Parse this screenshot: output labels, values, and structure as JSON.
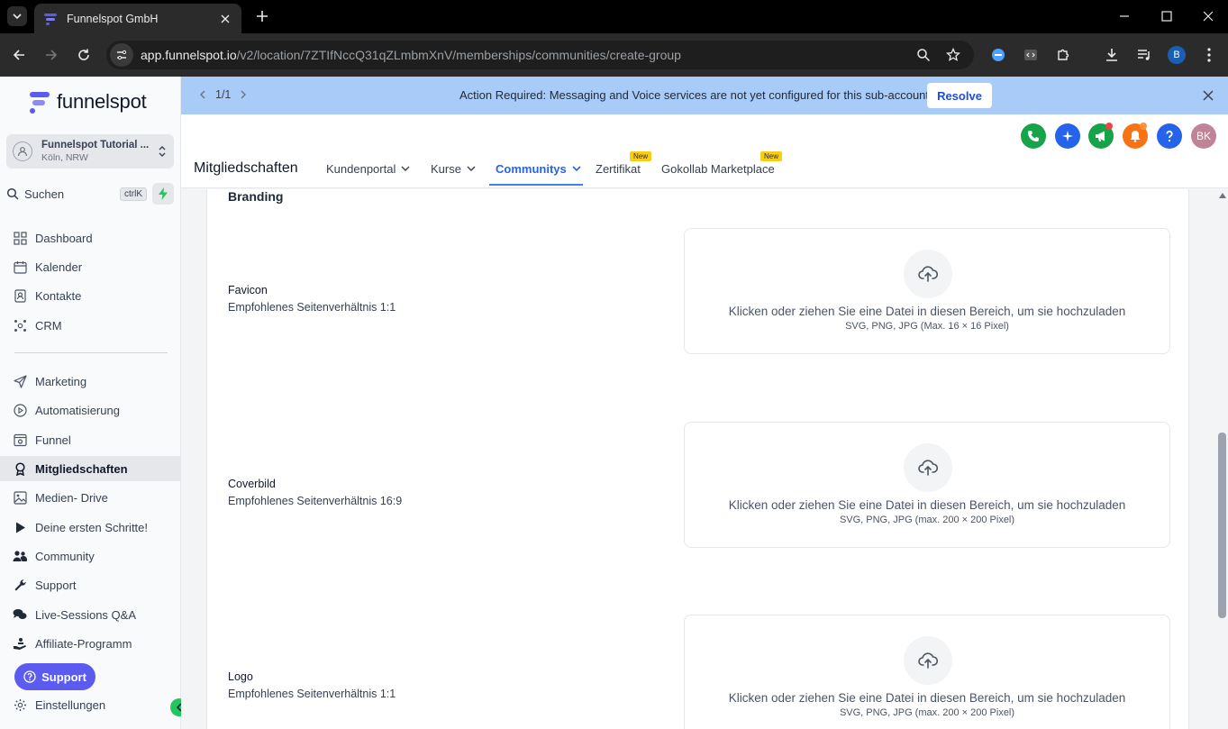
{
  "browser": {
    "tab_title": "Funnelspot GmbH",
    "url_host": "app.funnelspot.io",
    "url_path": "/v2/location/7ZTIfNccQ31qZLmbmXnV/memberships/communities/create-group",
    "profile_initial": "B"
  },
  "sidebar": {
    "logo_text": "funnelspot",
    "account_name": "Funnelspot Tutorial ...",
    "account_location": "Köln, NRW",
    "search_label": "Suchen",
    "search_shortcut": "ctrlK",
    "items": [
      {
        "label": "Dashboard",
        "icon": "dashboard-icon"
      },
      {
        "label": "Kalender",
        "icon": "calendar-icon"
      },
      {
        "label": "Kontakte",
        "icon": "contacts-icon"
      },
      {
        "label": "CRM",
        "icon": "crm-icon"
      },
      {
        "label": "Marketing",
        "icon": "send-icon"
      },
      {
        "label": "Automatisierung",
        "icon": "play-circle-icon"
      },
      {
        "label": "Funnel",
        "icon": "funnel-icon"
      },
      {
        "label": "Mitgliedschaften",
        "icon": "award-icon"
      },
      {
        "label": "Medien- Drive",
        "icon": "image-icon"
      },
      {
        "label": "Deine ersten Schritte!",
        "icon": "play-icon"
      },
      {
        "label": "Community",
        "icon": "users-icon"
      },
      {
        "label": "Support",
        "icon": "wrench-icon"
      },
      {
        "label": "Live-Sessions Q&A",
        "icon": "chat-icon"
      },
      {
        "label": "Affiliate-Programm",
        "icon": "hand-icon"
      },
      {
        "label": "Einstellungen",
        "icon": "gear-icon"
      }
    ],
    "support_button": "Support"
  },
  "banner": {
    "pager": "1/1",
    "message": "Action Required: Messaging and Voice services are not yet configured for this sub-account!",
    "resolve_label": "Resolve"
  },
  "header": {
    "title": "Mitgliedschaften",
    "avatar_initials": "BK",
    "tabs": [
      {
        "label": "Kundenportal"
      },
      {
        "label": "Kurse"
      },
      {
        "label": "Communitys"
      },
      {
        "label": "Zertifikat",
        "badge": "New"
      },
      {
        "label": "Gokollab Marketplace",
        "badge": "New"
      }
    ]
  },
  "branding": {
    "section_title": "Branding",
    "upload_text": "Klicken oder ziehen Sie eine Datei in diesen Bereich, um sie hochzuladen",
    "fields": [
      {
        "label": "Favicon",
        "hint": "Empfohlenes Seitenverhältnis 1:1",
        "formats": "SVG, PNG, JPG (Max. 16 × 16 Pixel)"
      },
      {
        "label": "Coverbild",
        "hint": "Empfohlenes Seitenverhältnis 16:9",
        "formats": "SVG, PNG, JPG (max. 200 × 200 Pixel)"
      },
      {
        "label": "Logo",
        "hint": "Empfohlenes Seitenverhältnis 1:1",
        "formats": "SVG, PNG, JPG (max. 200 × 200 Pixel)"
      }
    ]
  },
  "colors": {
    "accent": "#2563eb",
    "banner": "#a9cbf7",
    "support": "#5b5bf0"
  }
}
